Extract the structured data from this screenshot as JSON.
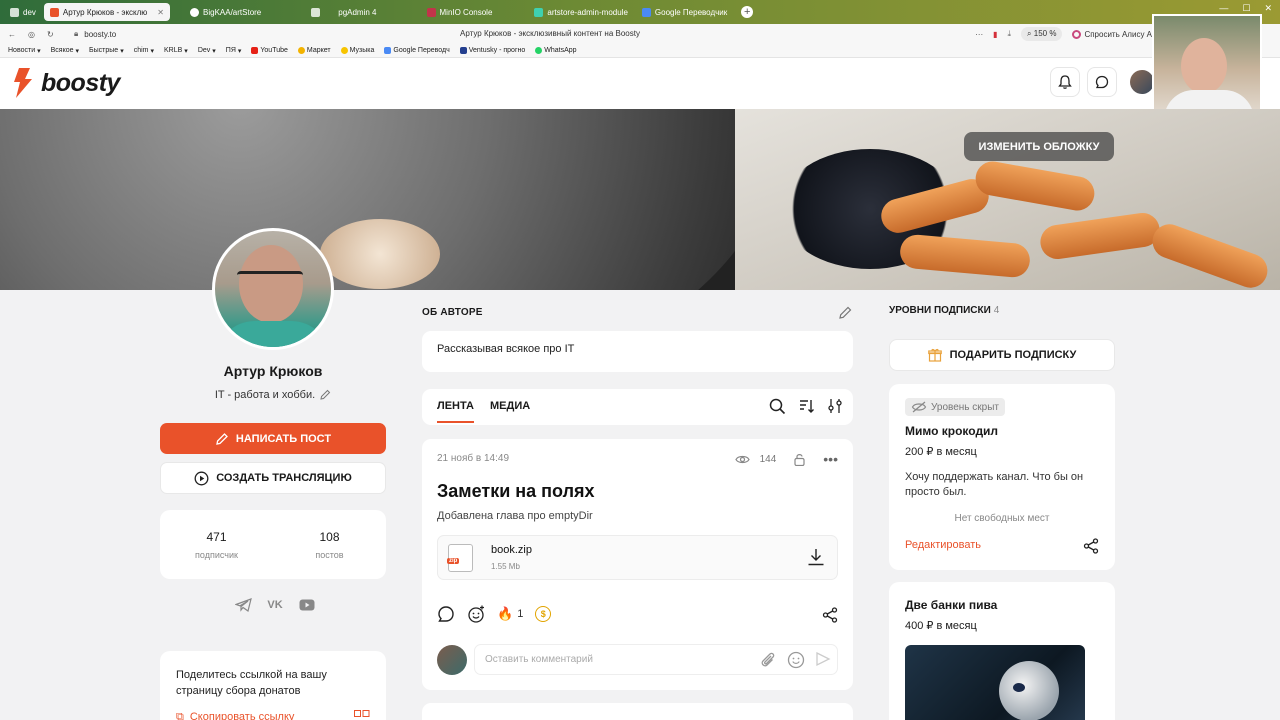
{
  "browser": {
    "tabs": [
      {
        "label": "dev",
        "active": false
      },
      {
        "label": "Артур Крюков - эксклю",
        "active": true
      },
      {
        "label": "BigKAA/artStore",
        "active": false
      },
      {
        "label": "pgAdmin 4",
        "active": false
      },
      {
        "label": "MinIO Console",
        "active": false
      },
      {
        "label": "artstore-admin-module",
        "active": false
      },
      {
        "label": "Google Переводчик",
        "active": false
      }
    ],
    "url": "boosty.to",
    "page_title": "Артур Крюков - эксклюзивный контент на Boosty",
    "zoom": "150 %",
    "alisa": "Спросить Алису А",
    "bookmarks": [
      "Новости",
      "Всякое",
      "Быстрые",
      "chim",
      "KRLB",
      "Dev",
      "ПЯ",
      "YouTube",
      "Маркет",
      "Музыка",
      "Google Переводч",
      "Ventusky - прогно",
      "WhatsApp"
    ]
  },
  "site": {
    "logo": "boosty",
    "cover_button": "ИЗМЕНИТЬ ОБЛОЖКУ"
  },
  "author": {
    "name": "Артур Крюков",
    "tagline": "IT - работа и хобби.",
    "write_post": "НАПИСАТЬ ПОСТ",
    "create_stream": "СОЗДАТЬ ТРАНСЛЯЦИЮ",
    "stats": [
      {
        "value": "471",
        "label": "подписчик"
      },
      {
        "value": "108",
        "label": "постов"
      }
    ],
    "share_text": "Поделитесь ссылкой на вашу страницу сбора донатов",
    "copy_link": "Скопировать ссылку"
  },
  "about": {
    "title": "ОБ АВТОРЕ",
    "text": "Рассказывая всякое про IT"
  },
  "feed": {
    "tabs": [
      "ЛЕНТА",
      "МЕДИА"
    ],
    "post": {
      "date": "21 нояб в 14:49",
      "views": "144",
      "title": "Заметки на полях",
      "subtitle": "Добавлена глава про emptyDir",
      "file_name": "book.zip",
      "file_size": "1.55 Mb",
      "file_ext": "zip",
      "fire_count": "1",
      "comment_placeholder": "Оставить комментарий"
    }
  },
  "levels": {
    "title": "УРОВНИ ПОДПИСКИ",
    "count": "4",
    "gift_button": "ПОДАРИТЬ ПОДПИСКУ",
    "tiers": [
      {
        "badge": "Уровень скрыт",
        "name": "Мимо крокодил",
        "price": "200 ₽ в месяц",
        "description": "Хочу поддержать канал. Что бы он просто был.",
        "availability": "Нет свободных мест",
        "edit": "Редактировать"
      },
      {
        "name": "Две банки пива",
        "price": "400 ₽ в месяц"
      }
    ]
  },
  "colors": {
    "accent": "#e9522a",
    "background": "#f2f2f3"
  }
}
